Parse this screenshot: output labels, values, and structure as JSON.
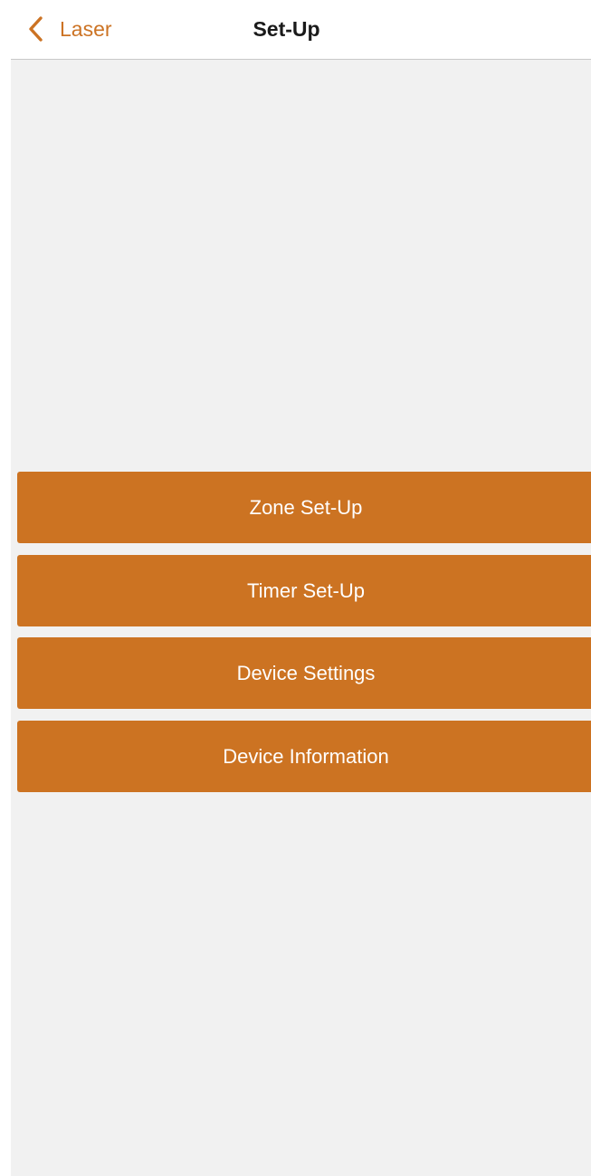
{
  "nav": {
    "back_label": "Laser",
    "title": "Set-Up"
  },
  "menu": {
    "items": [
      {
        "label": "Zone Set-Up"
      },
      {
        "label": "Timer Set-Up"
      },
      {
        "label": "Device Settings"
      },
      {
        "label": "Device Information"
      }
    ]
  },
  "icons": {
    "back": "chevron-left-icon"
  },
  "colors": {
    "accent": "#cc7322",
    "background": "#f1f1f1",
    "nav_background": "#ffffff",
    "title_text": "#1a1a1a",
    "button_text": "#ffffff"
  }
}
